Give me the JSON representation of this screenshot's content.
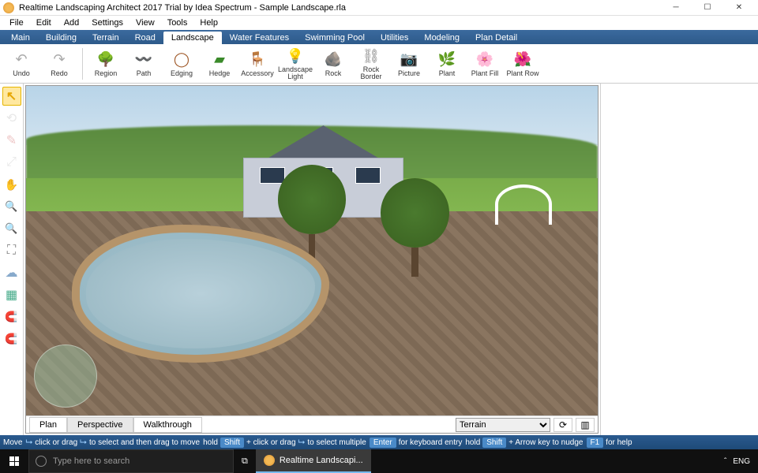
{
  "title": "Realtime Landscaping Architect 2017 Trial by Idea Spectrum - Sample Landscape.rla",
  "menus": [
    "File",
    "Edit",
    "Add",
    "Settings",
    "View",
    "Tools",
    "Help"
  ],
  "categoryTabs": [
    "Main",
    "Building",
    "Terrain",
    "Road",
    "Landscape",
    "Water Features",
    "Swimming Pool",
    "Utilities",
    "Modeling",
    "Plan Detail"
  ],
  "activeCategory": "Landscape",
  "toolbar": {
    "undo": "Undo",
    "redo": "Redo",
    "region": "Region",
    "path": "Path",
    "edging": "Edging",
    "hedge": "Hedge",
    "accessory": "Accessory",
    "light": "Landscape Light",
    "rock": "Rock",
    "rockborder": "Rock Border",
    "picture": "Picture",
    "plant": "Plant",
    "plantfill": "Plant Fill",
    "plantrow": "Plant Row"
  },
  "viewTabs": [
    "Plan",
    "Perspective",
    "Walkthrough"
  ],
  "activeViewTab": "Perspective",
  "viewSelect": "Terrain",
  "status": {
    "move": "Move",
    "seg1a": "click or drag",
    "seg1b": "to select and then drag to move",
    "hold": "hold",
    "shift": "Shift",
    "seg2a": "+ click or drag",
    "seg2b": "to select multiple",
    "enter": "Enter",
    "seg3": "for keyboard entry",
    "seg4": "+ Arrow key to nudge",
    "f1": "F1",
    "seg5": "for help"
  },
  "taskbar": {
    "search": "Type here to search",
    "app": "Realtime Landscapi...",
    "lang": "ENG"
  }
}
